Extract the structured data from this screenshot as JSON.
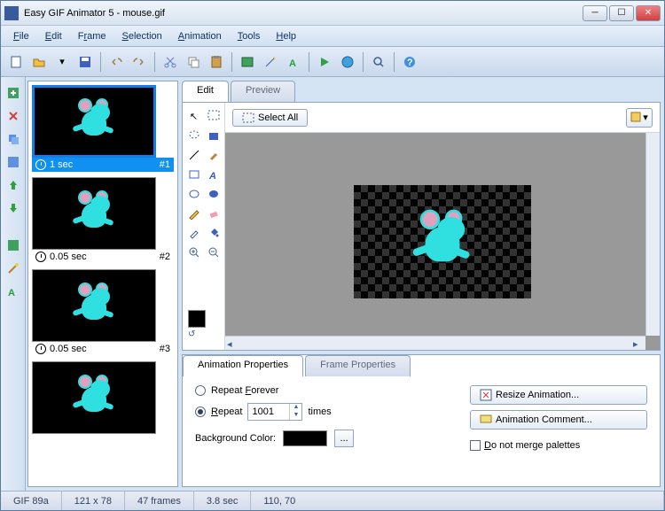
{
  "title": "Easy GIF Animator 5 - mouse.gif",
  "menu": [
    "File",
    "Edit",
    "Frame",
    "Selection",
    "Animation",
    "Tools",
    "Help"
  ],
  "frames": [
    {
      "delay": "1 sec",
      "num": "#1",
      "selected": true
    },
    {
      "delay": "0.05 sec",
      "num": "#2",
      "selected": false
    },
    {
      "delay": "0.05 sec",
      "num": "#3",
      "selected": false
    },
    {
      "delay": "",
      "num": "",
      "selected": false
    }
  ],
  "edit_tab": "Edit",
  "preview_tab": "Preview",
  "select_all": "Select All",
  "anim_props_tab": "Animation Properties",
  "frame_props_tab": "Frame Properties",
  "repeat_forever": "Repeat Forever",
  "repeat": "Repeat",
  "repeat_count": "1001",
  "times": "times",
  "bg_color_label": "Background Color:",
  "resize_anim": "Resize Animation...",
  "anim_comment": "Animation Comment...",
  "dont_merge": "Do not merge palettes",
  "status": {
    "format": "GIF 89a",
    "dims": "121 x 78",
    "frames": "47 frames",
    "dur": "3.8 sec",
    "pos": "110, 70"
  }
}
